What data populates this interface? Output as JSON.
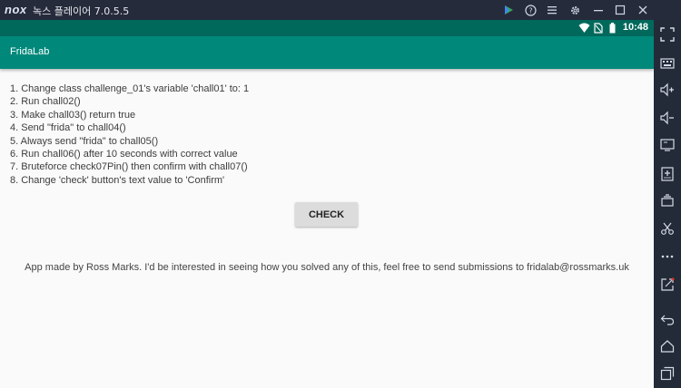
{
  "window": {
    "logo": "nox",
    "title": "녹스 플레이어 7.0.5.5",
    "controls": [
      "play-store-icon",
      "help-icon",
      "menu-icon",
      "settings-icon",
      "minimize-icon",
      "maximize-icon",
      "close-icon"
    ]
  },
  "statusbar": {
    "time": "10:48",
    "icons": [
      "wifi-icon",
      "no-sim-icon",
      "battery-icon"
    ]
  },
  "appbar": {
    "title": "FridaLab"
  },
  "instructions": [
    "1. Change class challenge_01's variable 'chall01' to: 1",
    "2. Run chall02()",
    "3. Make chall03() return true",
    "4. Send \"frida\" to chall04()",
    "5. Always send \"frida\" to chall05()",
    "6. Run chall06() after 10 seconds with correct value",
    "7. Bruteforce check07Pin() then confirm with chall07()",
    "8. Change 'check' button's text value to 'Confirm'"
  ],
  "check_button": {
    "label": "CHECK"
  },
  "footer": {
    "text": "App made by Ross Marks. I'd be interested in seeing how you solved any of this, feel free to send submissions to fridalab@rossmarks.uk"
  },
  "sidebar": {
    "tools": [
      "fullscreen-icon",
      "keyboard-icon",
      "volume-up-icon",
      "volume-down-icon",
      "screen-icon",
      "apk-install-icon",
      "multi-instance-icon",
      "scissors-icon",
      "more-icon",
      "shortcut-icon",
      "back-icon",
      "home-icon",
      "recent-apps-icon"
    ]
  }
}
